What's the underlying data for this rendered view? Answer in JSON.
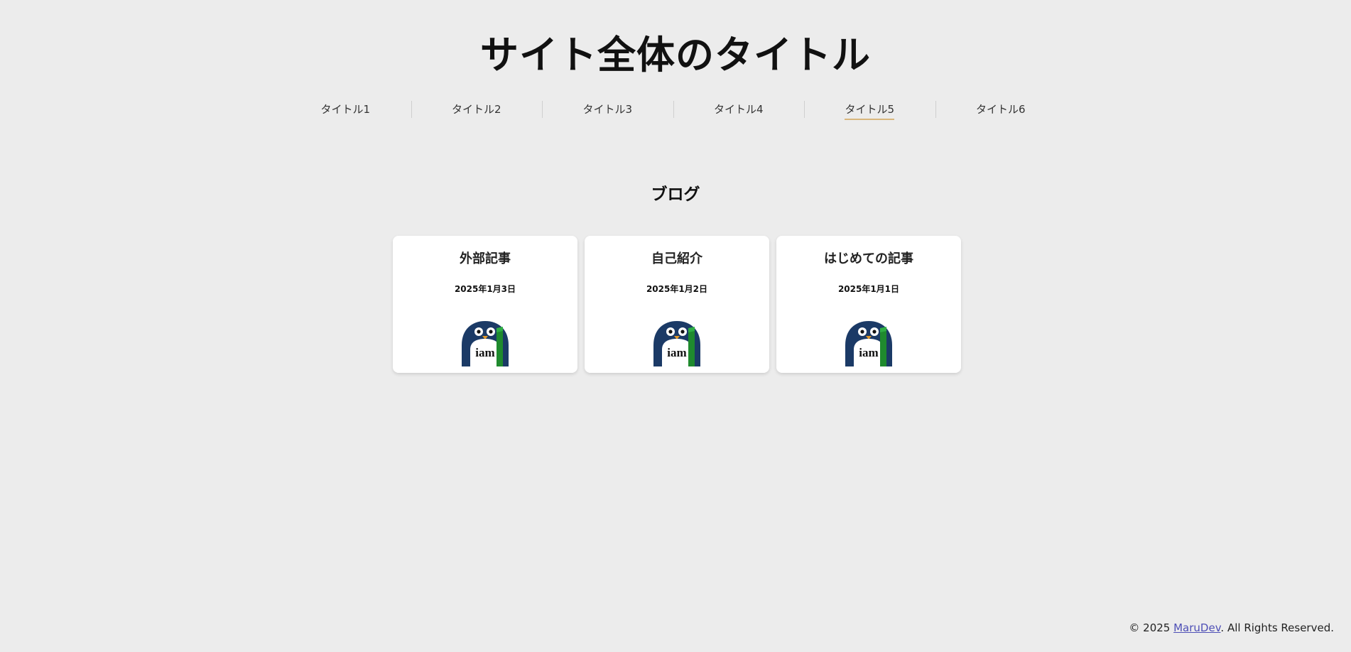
{
  "site": {
    "title": "サイト全体のタイトル"
  },
  "nav": {
    "items": [
      {
        "label": "タイトル1"
      },
      {
        "label": "タイトル2"
      },
      {
        "label": "タイトル3"
      },
      {
        "label": "タイトル4"
      },
      {
        "label": "タイトル5",
        "active": true
      },
      {
        "label": "タイトル6"
      }
    ],
    "active_underline_color": "#d9b67c"
  },
  "main": {
    "section_title": "ブログ",
    "cards": [
      {
        "title": "外部記事",
        "date": "2025年1月3日",
        "image_text": "iam",
        "image_icon": "penguin-icon"
      },
      {
        "title": "自己紹介",
        "date": "2025年1月2日",
        "image_text": "iam",
        "image_icon": "penguin-icon"
      },
      {
        "title": "はじめての記事",
        "date": "2025年1月1日",
        "image_text": "iam",
        "image_icon": "penguin-icon"
      }
    ]
  },
  "footer": {
    "prefix": "© 2025 ",
    "link_text": "MaruDev",
    "suffix": ". All Rights Reserved.",
    "link_color": "#4e4fb6"
  },
  "colors": {
    "background": "#ececec",
    "card_background": "#ffffff",
    "penguin_body": "#1b3a66",
    "penguin_accent": "#1f8a2e"
  }
}
